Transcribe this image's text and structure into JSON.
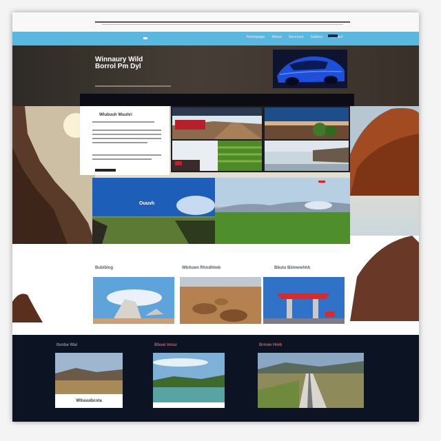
{
  "nav": {
    "items": [
      "Homepage",
      "About",
      "Services",
      "Gallery",
      "Contact"
    ]
  },
  "hero": {
    "title_line1": "Winnaury Wild",
    "title_line2": "Borrol Pm Dyl"
  },
  "featured_article": {
    "title": "Wlubuuh Wuuhri"
  },
  "wide_banner": {
    "label": "Ouuvh"
  },
  "cards": [
    {
      "title": "Bubiblog"
    },
    {
      "title": "Wbituwn Rhndhheb"
    },
    {
      "title": "Bbutu Biimwwhhh"
    }
  ],
  "footer": {
    "columns": [
      {
        "heading": "Itunbe Wal",
        "caption": "Wlluuuibcsta"
      },
      {
        "heading": "Bbuei Imuu",
        "caption": ""
      },
      {
        "heading": "Brnwe Hmb",
        "caption": ""
      }
    ]
  },
  "colors": {
    "nav_bar": "#5ab8e0",
    "footer_bg": "#0c1322",
    "accent_red": "#d82a2a"
  }
}
